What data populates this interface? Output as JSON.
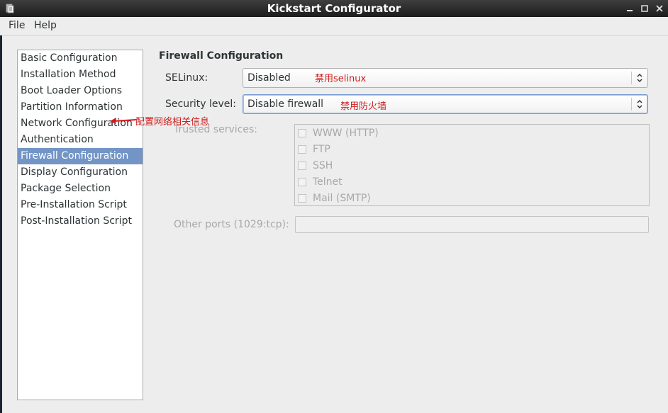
{
  "window": {
    "title": "Kickstart Configurator",
    "icon": "kickstart-app-icon",
    "controls": [
      "minimize-icon",
      "maximize-icon",
      "close-icon"
    ]
  },
  "menu": [
    "File",
    "Help"
  ],
  "sidebar": {
    "items": [
      {
        "label": "Basic Configuration"
      },
      {
        "label": "Installation Method"
      },
      {
        "label": "Boot Loader Options"
      },
      {
        "label": "Partition Information"
      },
      {
        "label": "Network Configuration"
      },
      {
        "label": "Authentication"
      },
      {
        "label": "Firewall Configuration",
        "selected": true
      },
      {
        "label": "Display Configuration"
      },
      {
        "label": "Package Selection"
      },
      {
        "label": "Pre-Installation Script"
      },
      {
        "label": "Post-Installation Script"
      }
    ]
  },
  "main": {
    "section_title": "Firewall Configuration",
    "selinux": {
      "label": "SELinux:",
      "value": "Disabled",
      "note": "禁用selinux"
    },
    "security_level": {
      "label": "Security level:",
      "value": "Disable firewall",
      "note": "禁用防火墙"
    },
    "trusted_services": {
      "label": "Trusted services:",
      "items": [
        "WWW (HTTP)",
        "FTP",
        "SSH",
        "Telnet",
        "Mail (SMTP)"
      ]
    },
    "other_ports": {
      "label": "Other ports (1029:tcp):",
      "value": ""
    }
  },
  "annotations": {
    "network_note": "配置网络相关信息",
    "color": "#d11b1b"
  },
  "colors": {
    "selection": "#7395c6",
    "titlebar": "#2a2a2a",
    "background": "#ededed"
  }
}
